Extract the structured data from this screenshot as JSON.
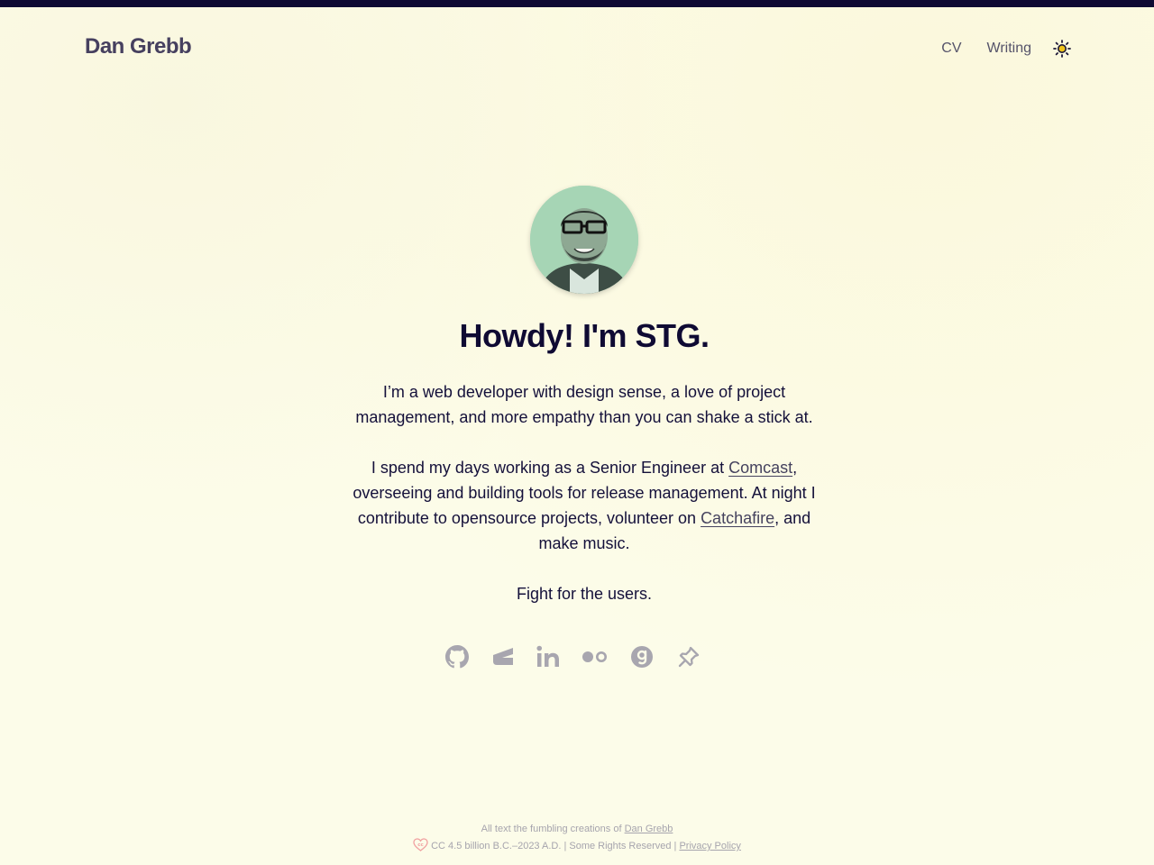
{
  "header": {
    "site_title": "Dan Grebb",
    "nav": [
      {
        "label": "CV"
      },
      {
        "label": "Writing"
      }
    ],
    "theme_toggle_icon": "sun-icon"
  },
  "hero": {
    "avatar_icon": "avatar-photo",
    "heading": "Howdy! I'm STG.",
    "intro": "I’m a web developer with design sense, a love of project management, and more empathy than you can shake a stick at.",
    "work": {
      "before": "I spend my days working as a Senior Engineer at ",
      "link1": "Comcast",
      "middle": ", overseeing and building tools for release management. At night I contribute to opensource projects, volunteer on ",
      "link2": "Catchafire",
      "after": ", and make music."
    },
    "motto": "Fight for the users."
  },
  "social": [
    {
      "icon": "github-icon"
    },
    {
      "icon": "codepen-icon"
    },
    {
      "icon": "linkedin-icon"
    },
    {
      "icon": "flickr-icon"
    },
    {
      "icon": "goodreads-icon"
    },
    {
      "icon": "pinboard-icon"
    }
  ],
  "footer": {
    "line1_prefix": "All text the fumbling creations of ",
    "line1_link": "Dan Grebb",
    "line2_text": "CC 4.5 billion B.C.–2023 A.D. | Some Rights Reserved | ",
    "line2_link": "Privacy Policy"
  },
  "colors": {
    "background": "#fcfce9",
    "topbar": "#0f0a33",
    "heading": "#0f0a33",
    "muted": "#a6a4ad",
    "icons": "#a8a6af",
    "sun": "#f0c419"
  }
}
